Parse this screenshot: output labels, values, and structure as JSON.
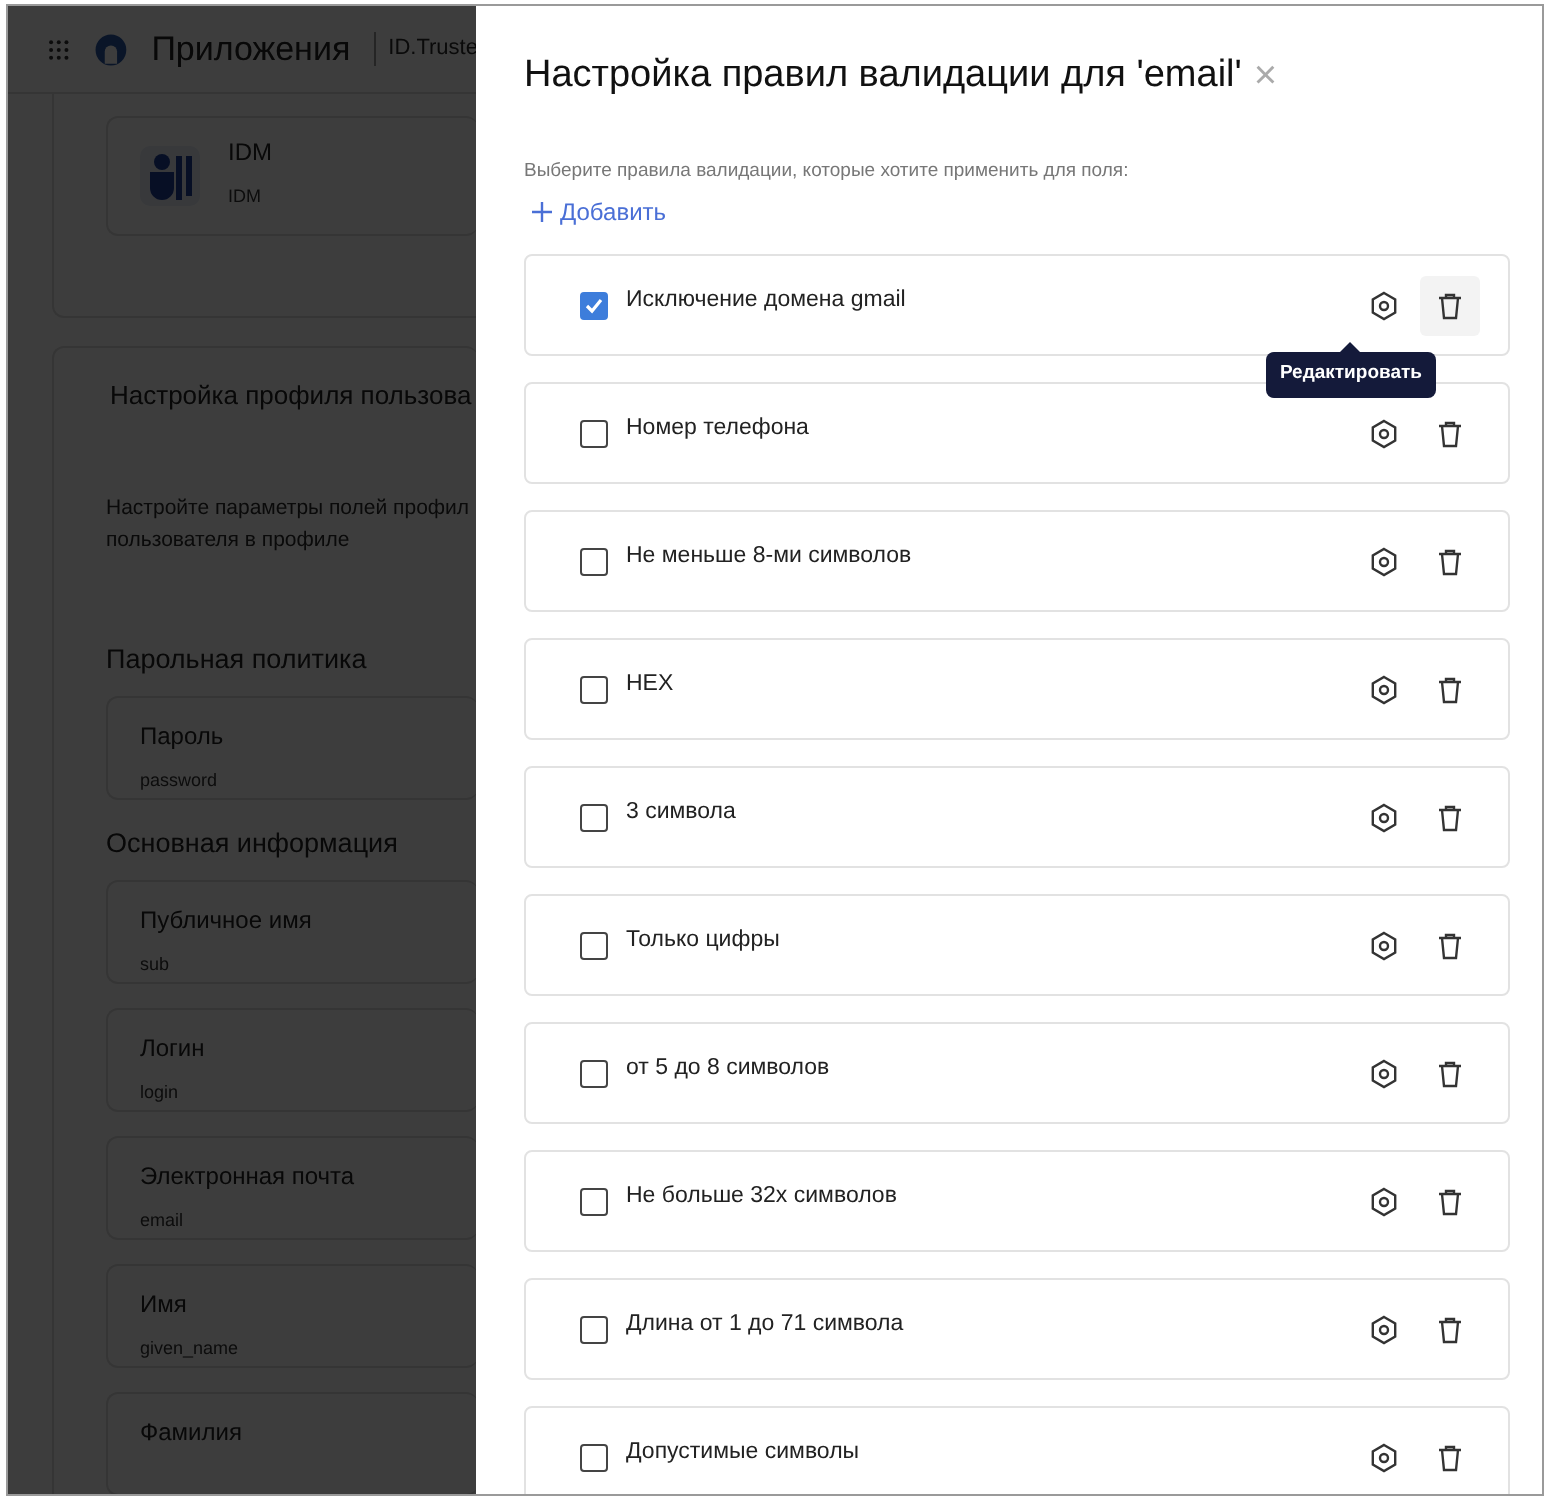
{
  "background_page": {
    "header": {
      "title": "Приложения",
      "subtitle": "ID.Truste"
    },
    "app_card": {
      "name": "IDM",
      "caption": "IDM"
    },
    "profile_section": {
      "title": "Настройка профиля пользова",
      "description_lines": [
        "Настройте параметры полей профил",
        "пользователя в профиле"
      ]
    },
    "groups": [
      {
        "title": "Парольная политика",
        "fields": [
          {
            "label": "Пароль",
            "value": "password"
          }
        ]
      },
      {
        "title": "Основная информация",
        "fields": [
          {
            "label": "Публичное имя",
            "value": "sub"
          },
          {
            "label": "Логин",
            "value": "login"
          },
          {
            "label": "Электронная почта",
            "value": "email"
          },
          {
            "label": "Имя",
            "value": "given_name"
          },
          {
            "label": "Фамилия"
          }
        ]
      }
    ]
  },
  "drawer": {
    "title": "Настройка правил валидации для 'email'",
    "close": "×",
    "hint": "Выберите правила валидации, которые хотите применить для поля:",
    "add_button": "Добавить",
    "rules": [
      {
        "label": "Исключение домена gmail",
        "checked": true,
        "tooltip": "Редактировать"
      },
      {
        "label": "Номер телефона",
        "checked": false
      },
      {
        "label": "Не меньше 8-ми символов",
        "checked": false
      },
      {
        "label": "HEX",
        "checked": false
      },
      {
        "label": "3 символа",
        "checked": false
      },
      {
        "label": "Только цифры",
        "checked": false
      },
      {
        "label": "от 5 до 8 символов",
        "checked": false
      },
      {
        "label": "Не больше 32х символов",
        "checked": false
      },
      {
        "label": "Длина от 1 до 71 символа",
        "checked": false
      },
      {
        "label": "Допустимые символы",
        "checked": false
      }
    ]
  }
}
